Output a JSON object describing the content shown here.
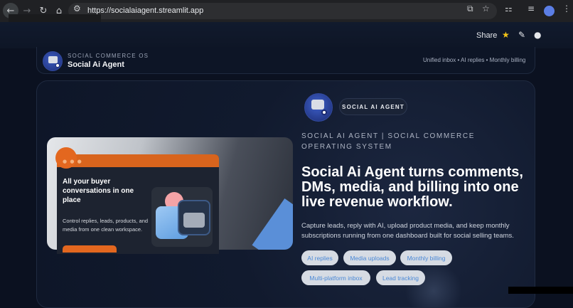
{
  "browser": {
    "url": "https://socialaiagent.streamlit.app",
    "back_icon": "arrow-left-icon",
    "forward_icon": "arrow-right-icon",
    "reload_icon": "reload-icon",
    "home_icon": "home-icon",
    "avatar_initial": "•"
  },
  "streamlit_header": {
    "share_label": "Share"
  },
  "topcard": {
    "eyebrow": "SOCIAL COMMERCE OS",
    "app_name": "Social Ai Agent",
    "features_line": "Unified inbox • AI replies • Monthly billing"
  },
  "mockup": {
    "heading": "All your buyer conversations in one place",
    "body": "Control replies, leads, products, and media from one clean workspace.",
    "dots": "● ● ●"
  },
  "hero": {
    "badge": "SOCIAL AI AGENT",
    "kicker": "SOCIAL AI AGENT | SOCIAL COMMERCE OPERATING SYSTEM",
    "headline": "Social Ai Agent turns comments, DMs, media, and billing into one live revenue workflow.",
    "description": "Capture leads, reply with AI, upload product media, and keep monthly subscriptions running from one dashboard built for social selling teams.",
    "tags": [
      "AI replies",
      "Media uploads",
      "Monthly billing",
      "Multi-platform inbox",
      "Lead tracking"
    ]
  },
  "colors": {
    "accent_orange": "#e3671f",
    "tag_text_blue": "#4a88d6",
    "star_yellow": "#f5c518"
  }
}
